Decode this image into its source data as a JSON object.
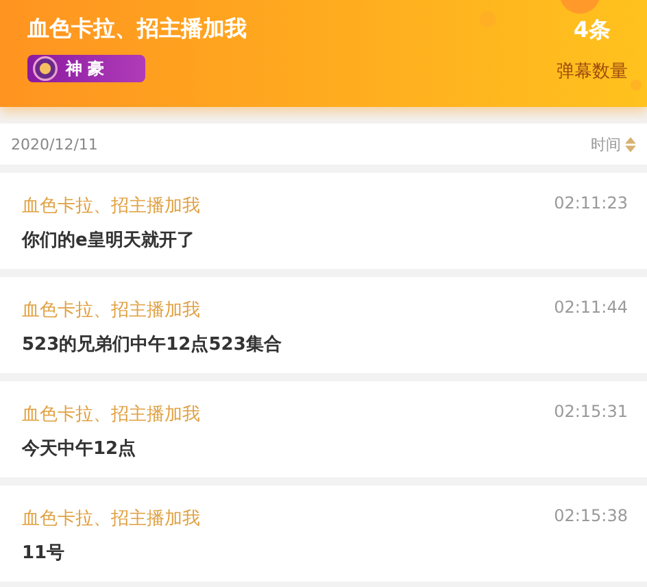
{
  "header": {
    "user_name": "血色卡拉、招主播加我",
    "badge": "神豪",
    "count": "4条",
    "count_label": "弹幕数量"
  },
  "date_bar": {
    "date": "2020/12/11",
    "sort_label": "时间"
  },
  "messages": [
    {
      "sender": "血色卡拉、招主播加我",
      "time": "02:11:23",
      "text": "你们的e皇明天就开了"
    },
    {
      "sender": "血色卡拉、招主播加我",
      "time": "02:11:44",
      "text": "523的兄弟们中午12点523集合"
    },
    {
      "sender": "血色卡拉、招主播加我",
      "time": "02:15:31",
      "text": "今天中午12点"
    },
    {
      "sender": "血色卡拉、招主播加我",
      "time": "02:15:38",
      "text": "11号"
    }
  ]
}
